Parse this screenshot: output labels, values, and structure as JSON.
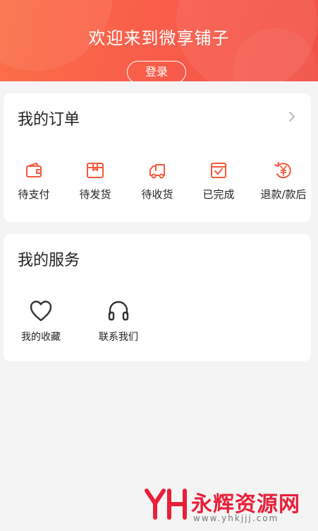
{
  "header": {
    "welcome": "欢迎来到微享铺子",
    "login_label": "登录"
  },
  "orders": {
    "title": "我的订单",
    "items": [
      {
        "label": "待支付",
        "icon": "wallet-icon"
      },
      {
        "label": "待发货",
        "icon": "package-icon"
      },
      {
        "label": "待收货",
        "icon": "delivery-truck-icon"
      },
      {
        "label": "已完成",
        "icon": "completed-check-icon"
      },
      {
        "label": "退款/款后",
        "icon": "refund-yen-icon"
      }
    ]
  },
  "services": {
    "title": "我的服务",
    "items": [
      {
        "label": "我的收藏",
        "icon": "heart-icon"
      },
      {
        "label": "联系我们",
        "icon": "headphones-icon"
      }
    ]
  },
  "watermark": {
    "text": "永辉资源网",
    "url": "www.yhkjjj.com"
  },
  "colors": {
    "header_start": "#fb6f48",
    "header_end": "#f25246",
    "order_icon": "#f35a3d",
    "service_icon": "#333333",
    "watermark": "#e8203a"
  }
}
